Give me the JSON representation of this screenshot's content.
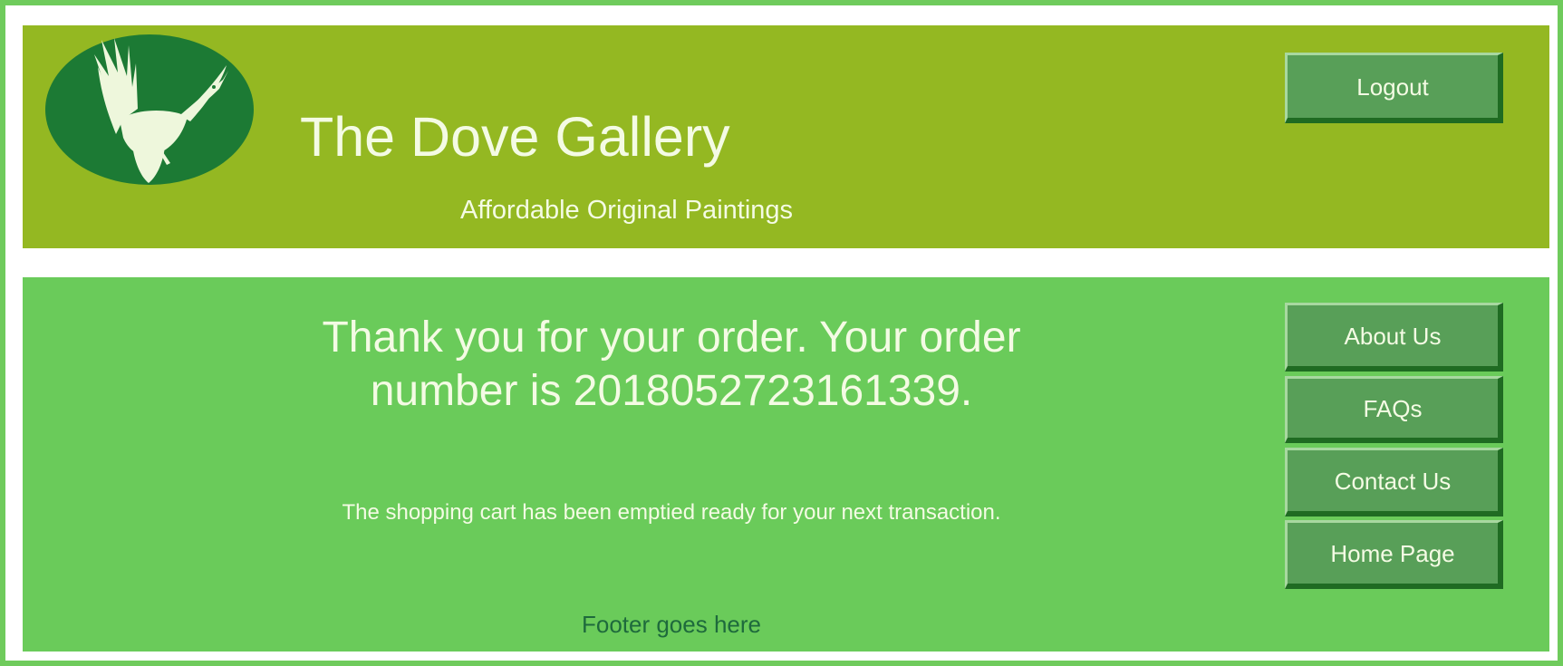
{
  "header": {
    "site_title": "The Dove Gallery",
    "tagline": "Affordable Original Paintings",
    "logout_label": "Logout",
    "logo_icon": "dove-logo-icon"
  },
  "main": {
    "thank_you": "Thank you for your order. Your order number is 20180527231613‌39.",
    "cart_note": "The shopping cart has been emptied ready for your next transaction.",
    "footer_text": "Footer goes here"
  },
  "nav": {
    "items": [
      "About Us",
      "FAQs",
      "Contact Us",
      "Home Page"
    ]
  },
  "colors": {
    "header_bg": "#94b822",
    "main_bg": "#6acb5a",
    "button_bg": "#589f58",
    "logo_bg": "#1c7a34",
    "text_light": "#f4fbe4",
    "footer_text": "#1e6a3c"
  }
}
